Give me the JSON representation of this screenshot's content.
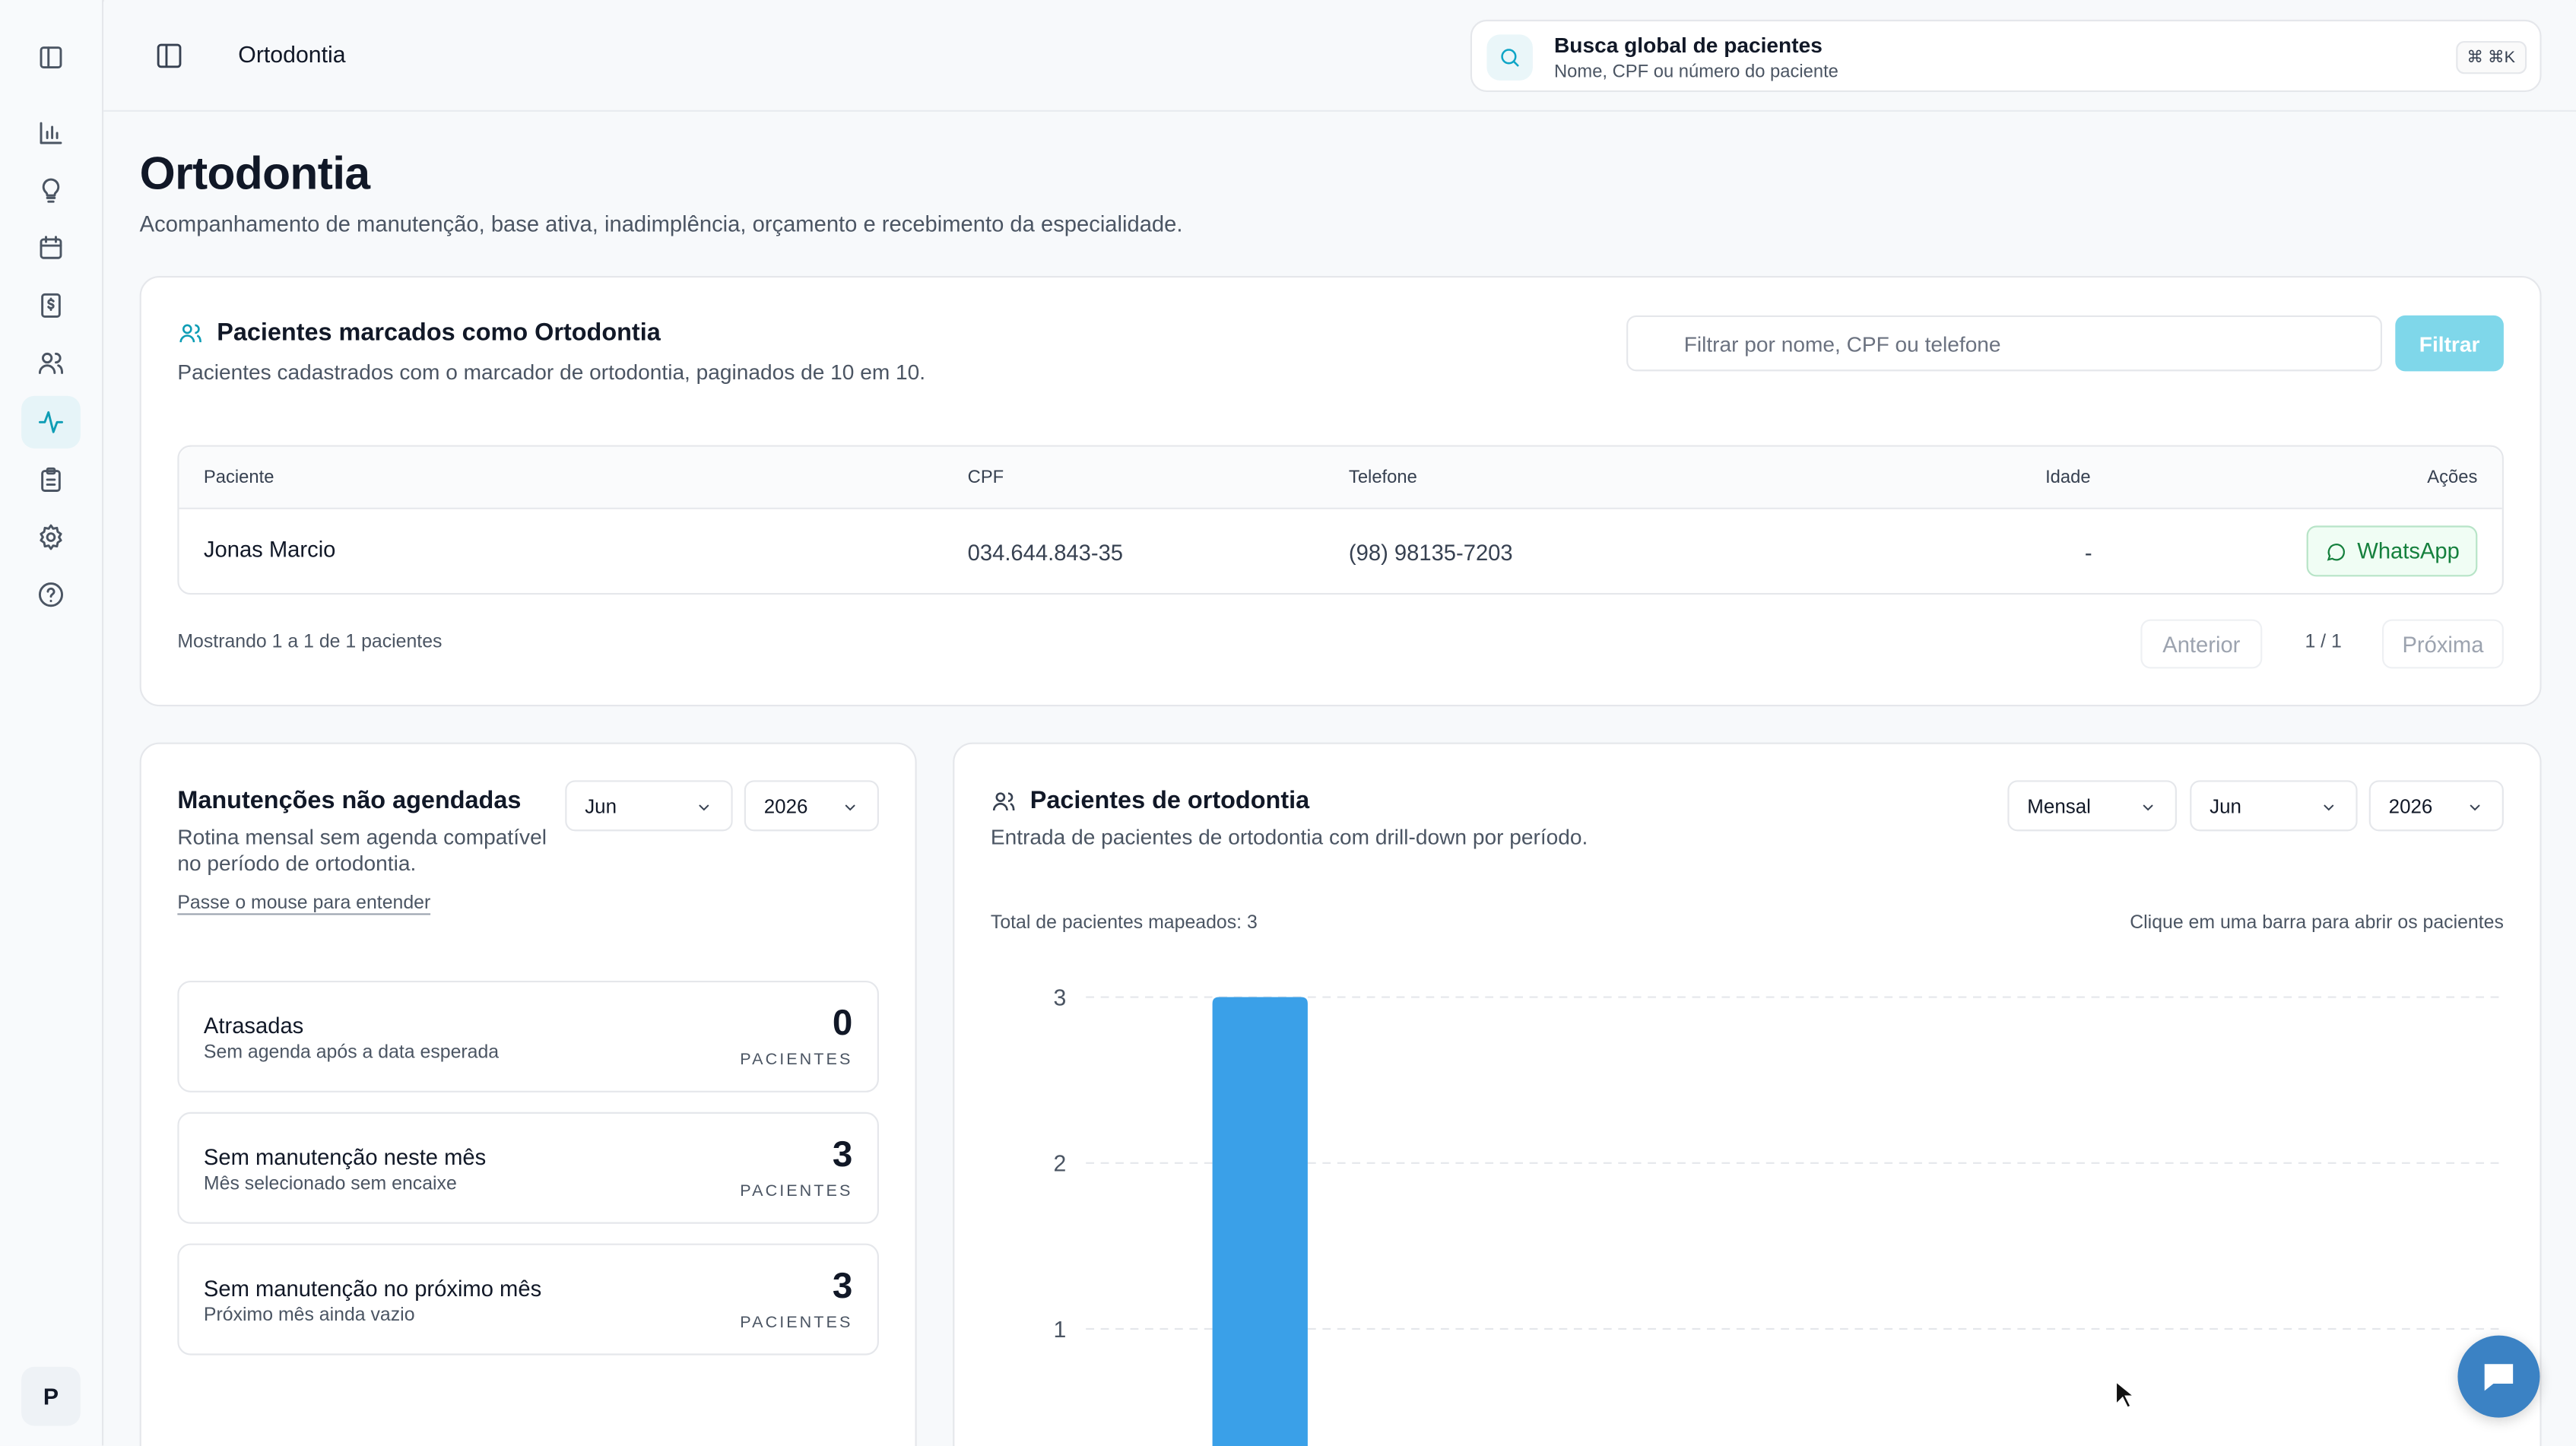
{
  "topbar": {
    "breadcrumb": "Ortodontia",
    "global_search": {
      "title": "Busca global de pacientes",
      "subtitle": "Nome, CPF ou número do paciente",
      "shortcut": "⌘ ⌘K"
    }
  },
  "sidebar": {
    "items": [
      {
        "icon": "panel-icon"
      },
      {
        "icon": "bar-chart-icon"
      },
      {
        "icon": "lightbulb-icon"
      },
      {
        "icon": "calendar-icon"
      },
      {
        "icon": "dollar-icon"
      },
      {
        "icon": "users-icon"
      },
      {
        "icon": "activity-icon",
        "active": true
      },
      {
        "icon": "clipboard-icon"
      },
      {
        "icon": "gear-icon"
      },
      {
        "icon": "help-icon"
      }
    ],
    "avatar": "P"
  },
  "page": {
    "title": "Ortodontia",
    "subtitle": "Acompanhamento de manutenção, base ativa, inadimplência, orçamento e recebimento da especialidade."
  },
  "patients": {
    "title": "Pacientes marcados como Ortodontia",
    "subtitle": "Pacientes cadastrados com o marcador de ortodontia, paginados de 10 em 10.",
    "filter_placeholder": "Filtrar por nome, CPF ou telefone",
    "filter_button": "Filtrar",
    "columns": {
      "patient": "Paciente",
      "cpf": "CPF",
      "phone": "Telefone",
      "age": "Idade",
      "actions": "Ações"
    },
    "rows": [
      {
        "name": "Jonas Marcio",
        "cpf": "034.644.843-35",
        "phone": "(98) 98135-7203",
        "age": "-",
        "action": "WhatsApp"
      }
    ],
    "showing": "Mostrando 1 a 1 de 1 pacientes",
    "prev": "Anterior",
    "page": "1 / 1",
    "next": "Próxima"
  },
  "maintenance": {
    "title": "Manutenções não agendadas",
    "subtitle": "Rotina mensal sem agenda compatível no período de ortodontia.",
    "hint_link": "Passe o mouse para entender",
    "month": "Jun",
    "year": "2026",
    "stats": [
      {
        "title": "Atrasadas",
        "sub": "Sem agenda após a data esperada",
        "value": "0",
        "label": "PACIENTES"
      },
      {
        "title": "Sem manutenção neste mês",
        "sub": "Mês selecionado sem encaixe",
        "value": "3",
        "label": "PACIENTES"
      },
      {
        "title": "Sem manutenção no próximo mês",
        "sub": "Próximo mês ainda vazio",
        "value": "3",
        "label": "PACIENTES"
      }
    ]
  },
  "ortho_chart": {
    "title": "Pacientes de ortodontia",
    "subtitle": "Entrada de pacientes de ortodontia com drill-down por período.",
    "period": "Mensal",
    "month": "Jun",
    "year": "2026",
    "total": "Total de pacientes mapeados: 3",
    "hint": "Clique em uma barra para abrir os pacientes"
  },
  "chart_data": {
    "type": "bar",
    "categories": [
      ""
    ],
    "values": [
      3
    ],
    "yticks": [
      1,
      2,
      3
    ],
    "ylim": [
      0,
      3
    ],
    "grid": true,
    "bar_color": "#3aa0e8"
  },
  "colors": {
    "accent": "#0e9db5",
    "filter_button": "#7fd7ea",
    "whatsapp": "#15803d"
  }
}
